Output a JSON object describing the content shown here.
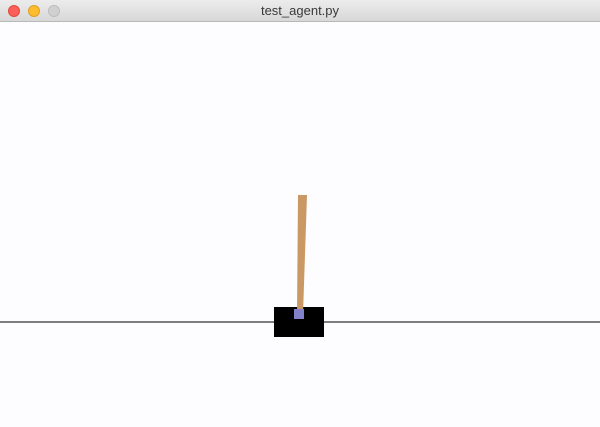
{
  "window": {
    "title": "test_agent.py",
    "buttons": {
      "close": {
        "icon": "close-icon",
        "color": "#fc5f57"
      },
      "minimize": {
        "icon": "minimize-icon",
        "color": "#fdbc2e"
      },
      "maximize": {
        "icon": "maximize-icon",
        "color": "#d0d0d0"
      }
    }
  },
  "scene": {
    "background_color": "#fdfcfe",
    "track_color": "#000000",
    "cart_color": "#000000",
    "pole_color": "#ca9865",
    "axle_color": "#8180cb"
  }
}
